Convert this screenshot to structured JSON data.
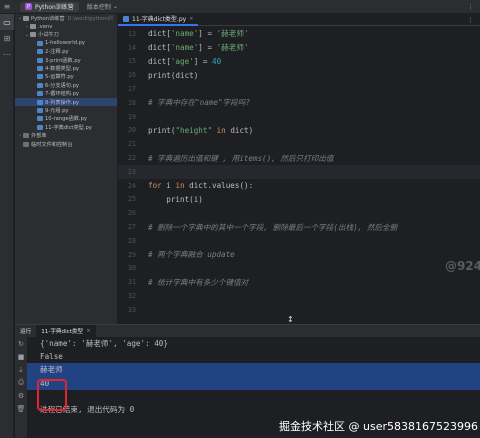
{
  "titlebar": {
    "menu_icon": "hamburger-icon",
    "project_badge": "P",
    "project_name": "Python训练营",
    "vcs_label": "版本控制",
    "vcs_chevron": "⌄",
    "right_icon": "⋮"
  },
  "toolstrip": [
    "folder-icon",
    "structure-icon",
    "more-icon"
  ],
  "project_tree": [
    {
      "label": "Python训练营",
      "dim": "D:\\work\\python训",
      "indent": 0,
      "arrow": "⌄",
      "icon": "folder"
    },
    {
      "label": ".venv",
      "dim": "",
      "indent": 1,
      "arrow": "›",
      "icon": "folder"
    },
    {
      "label": "小试牛刀",
      "dim": "",
      "indent": 1,
      "arrow": "⌄",
      "icon": "folder"
    },
    {
      "label": "1-helloworld.py",
      "dim": "",
      "indent": 2,
      "arrow": "",
      "icon": "py"
    },
    {
      "label": "2-注释.py",
      "dim": "",
      "indent": 2,
      "arrow": "",
      "icon": "py"
    },
    {
      "label": "3-print函数.py",
      "dim": "",
      "indent": 2,
      "arrow": "",
      "icon": "py"
    },
    {
      "label": "4-数据类型.py",
      "dim": "",
      "indent": 2,
      "arrow": "",
      "icon": "py"
    },
    {
      "label": "5-运算符.py",
      "dim": "",
      "indent": 2,
      "arrow": "",
      "icon": "py"
    },
    {
      "label": "6-分支语句.py",
      "dim": "",
      "indent": 2,
      "arrow": "",
      "icon": "py"
    },
    {
      "label": "7-循环结构.py",
      "dim": "",
      "indent": 2,
      "arrow": "",
      "icon": "py"
    },
    {
      "label": "8-列表操作.py",
      "dim": "",
      "indent": 2,
      "arrow": "",
      "icon": "py",
      "selected": true
    },
    {
      "label": "9-元组.py",
      "dim": "",
      "indent": 2,
      "arrow": "",
      "icon": "py"
    },
    {
      "label": "10-range函数.py",
      "dim": "",
      "indent": 2,
      "arrow": "",
      "icon": "py"
    },
    {
      "label": "11-字典dict类型.py",
      "dim": "",
      "indent": 2,
      "arrow": "",
      "icon": "py"
    },
    {
      "label": "外部库",
      "dim": "",
      "indent": 0,
      "arrow": "›",
      "icon": "lib"
    },
    {
      "label": "临时文件和控制台",
      "dim": "",
      "indent": 0,
      "arrow": "",
      "icon": "lib"
    }
  ],
  "editor": {
    "tab_label": "11-字典dict类型.py",
    "tab_close": "×",
    "more": "⋮",
    "watermark": "@924",
    "lines": [
      {
        "n": "13",
        "html": [
          [
            "f",
            "dict["
          ],
          [
            "s",
            "'name'"
          ],
          [
            "f",
            "] = "
          ],
          [
            "s",
            "'赫老师'"
          ]
        ]
      },
      {
        "n": "14",
        "html": [
          [
            "f",
            "dict["
          ],
          [
            "s",
            "'name'"
          ],
          [
            "f",
            "] = "
          ],
          [
            "s",
            "'赫老师'"
          ]
        ]
      },
      {
        "n": "15",
        "html": [
          [
            "f",
            "dict["
          ],
          [
            "s",
            "'age'"
          ],
          [
            "f",
            "] = "
          ],
          [
            "n",
            "40"
          ]
        ]
      },
      {
        "n": "16",
        "html": [
          [
            "f",
            "print(dict)"
          ]
        ]
      },
      {
        "n": "17",
        "html": []
      },
      {
        "n": "18",
        "html": [
          [
            "c",
            "# 字典中存在\"name\"字段吗?"
          ]
        ]
      },
      {
        "n": "19",
        "html": []
      },
      {
        "n": "20",
        "html": [
          [
            "f",
            "print("
          ],
          [
            "s",
            "\"height\""
          ],
          [
            "f",
            " "
          ],
          [
            "k",
            "in"
          ],
          [
            "f",
            " dict)"
          ]
        ]
      },
      {
        "n": "21",
        "html": []
      },
      {
        "n": "22",
        "html": [
          [
            "c",
            "# 字典遍历出值和键 , 用items(), 然后只打印出值"
          ]
        ]
      },
      {
        "n": "23",
        "html": [],
        "current": true
      },
      {
        "n": "24",
        "html": [
          [
            "k",
            "for"
          ],
          [
            "f",
            " i "
          ],
          [
            "k",
            "in"
          ],
          [
            "f",
            " dict.values():"
          ]
        ]
      },
      {
        "n": "25",
        "html": [
          [
            "f",
            "    print(i)"
          ]
        ]
      },
      {
        "n": "26",
        "html": []
      },
      {
        "n": "27",
        "html": [
          [
            "c",
            "# 删除一个字典中的其中一个字段, 删除最后一个字段(出栈), 然后全删"
          ]
        ]
      },
      {
        "n": "28",
        "html": []
      },
      {
        "n": "29",
        "html": [
          [
            "c",
            "# 两个字典融合 update"
          ]
        ]
      },
      {
        "n": "30",
        "html": []
      },
      {
        "n": "31",
        "html": [
          [
            "c",
            "# 统计字典中有多少个键值对"
          ]
        ]
      },
      {
        "n": "32",
        "html": []
      },
      {
        "n": "33",
        "html": []
      }
    ]
  },
  "run_panel": {
    "label": "运行",
    "tab_label": "11-字典dict类型",
    "tab_close": "×",
    "side_icons": [
      "rerun-icon",
      "stop-icon",
      "scroll-icon",
      "print-icon",
      "settings-icon",
      "delete-icon"
    ],
    "output": [
      {
        "text": "{'name': '赫老师', 'age': 40}",
        "hl": false
      },
      {
        "text": "False",
        "hl": false
      },
      {
        "text": "赫老师",
        "hl": true
      },
      {
        "text": "40",
        "hl": true
      },
      {
        "text": "",
        "hl": false
      },
      {
        "text": "进程已结束, 退出代码为 0",
        "hl": false
      }
    ]
  },
  "footer_watermark": "掘金技术社区 @ user5838167523996"
}
